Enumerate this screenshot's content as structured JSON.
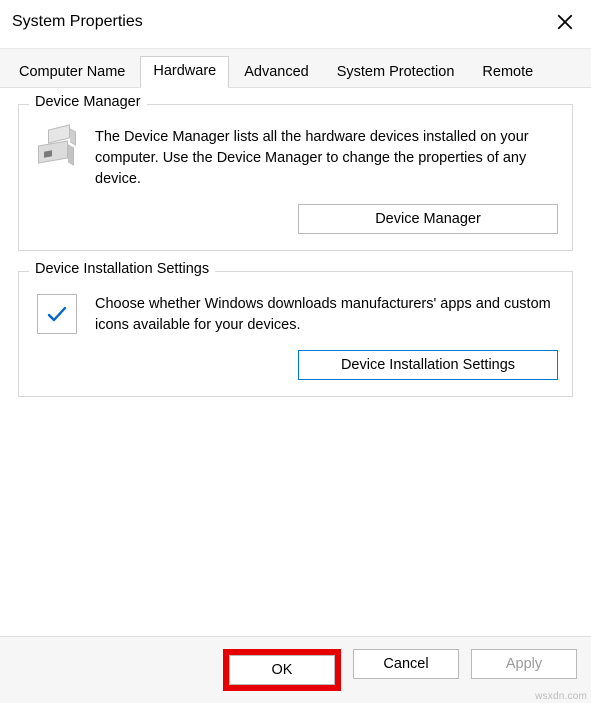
{
  "window": {
    "title": "System Properties"
  },
  "tabs": [
    {
      "label": "Computer Name"
    },
    {
      "label": "Hardware"
    },
    {
      "label": "Advanced"
    },
    {
      "label": "System Protection"
    },
    {
      "label": "Remote"
    }
  ],
  "groups": {
    "device_manager": {
      "legend": "Device Manager",
      "desc": "The Device Manager lists all the hardware devices installed on your computer. Use the Device Manager to change the properties of any device.",
      "button": "Device Manager"
    },
    "device_install": {
      "legend": "Device Installation Settings",
      "desc": "Choose whether Windows downloads manufacturers' apps and custom icons available for your devices.",
      "button": "Device Installation Settings"
    }
  },
  "buttons": {
    "ok": "OK",
    "cancel": "Cancel",
    "apply": "Apply"
  },
  "watermark": "wsxdn.com"
}
